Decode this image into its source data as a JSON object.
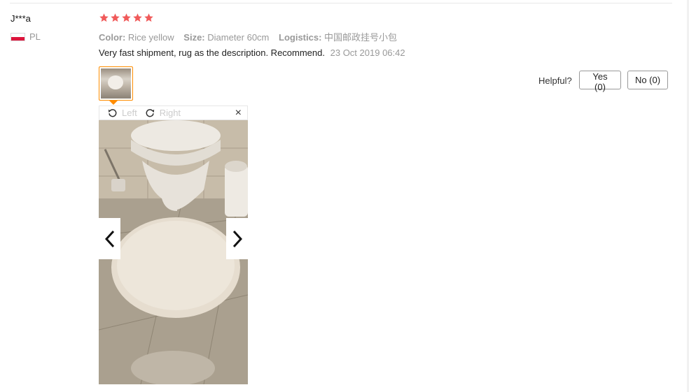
{
  "review": {
    "buyer": "J***a",
    "country": "PL",
    "rating": 5,
    "color_label": "Color:",
    "color_value": "Rice yellow",
    "size_label": "Size:",
    "size_value": "Diameter 60cm",
    "logistics_label": "Logistics:",
    "logistics_value": "中国邮政挂号小包",
    "text": "Very fast shipment, rug as the description. Recommend.",
    "date": "23 Oct 2019 06:42"
  },
  "helpful": {
    "label": "Helpful?",
    "yes": "Yes (0)",
    "no": "No (0)"
  },
  "viewer": {
    "rotate_left": "Left",
    "rotate_right": "Right",
    "close": "×"
  },
  "colors": {
    "star": "#f05a5a",
    "thumb_border": "#ff8c00",
    "flag_red": "#dc143c"
  },
  "icons": [
    "star-icon",
    "flag-pl-icon",
    "rotate-left-icon",
    "rotate-right-icon",
    "close-icon",
    "chevron-left-icon",
    "chevron-right-icon"
  ]
}
